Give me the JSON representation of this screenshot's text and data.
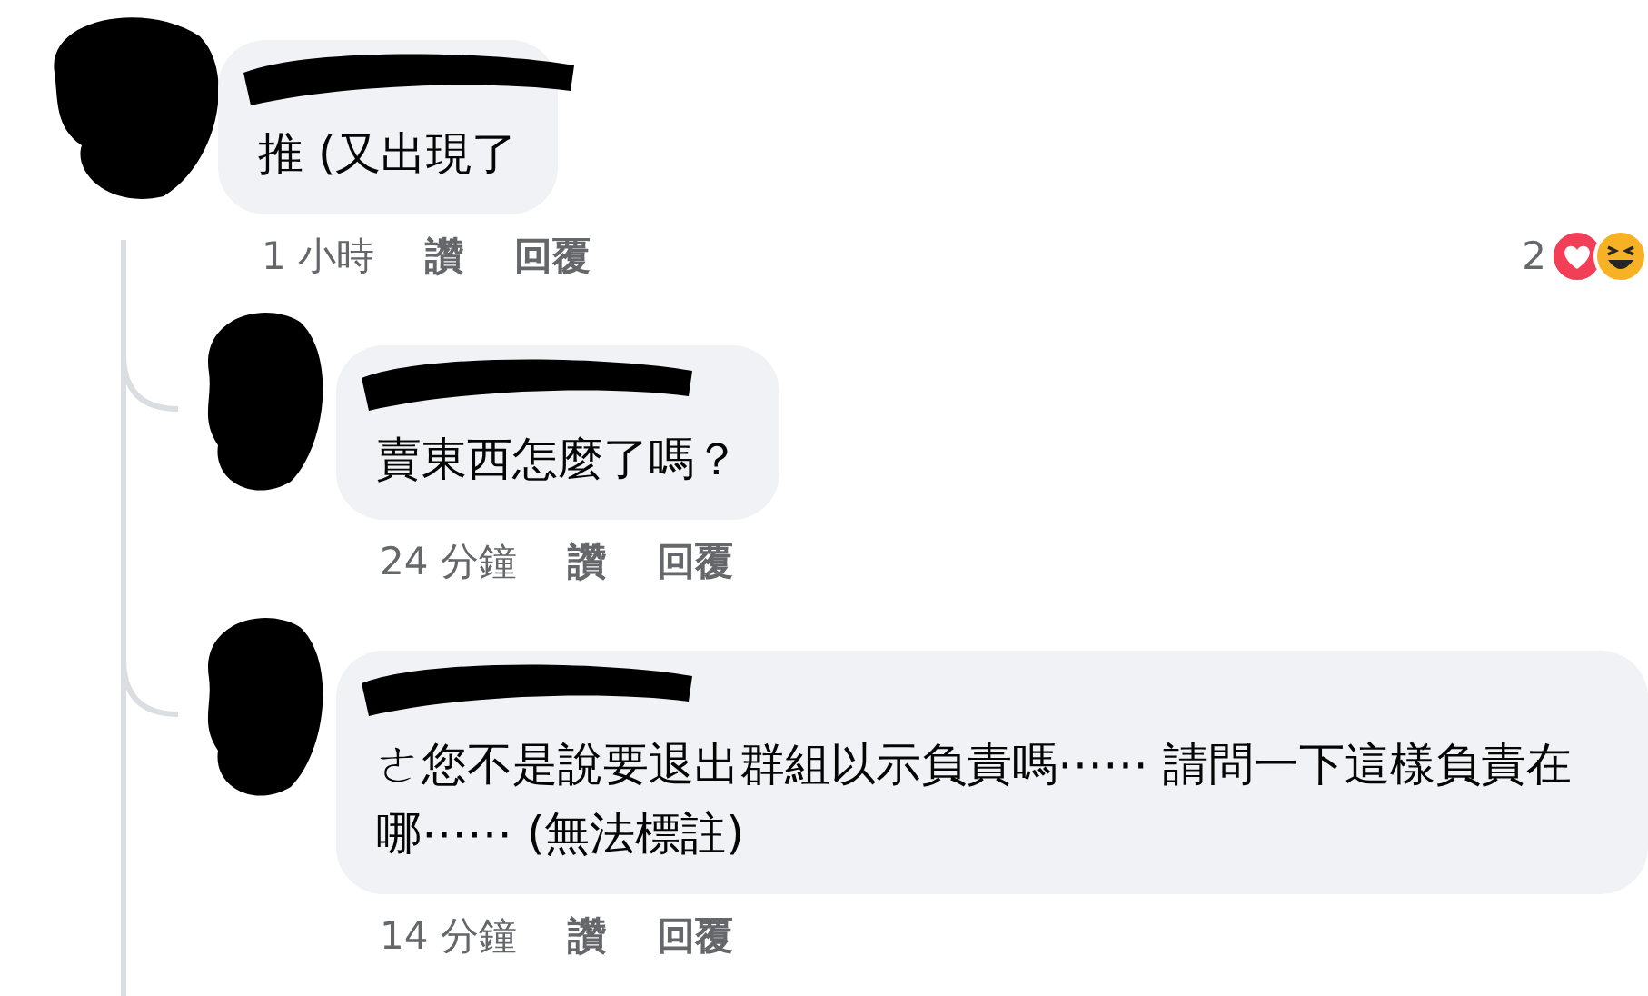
{
  "comments": [
    {
      "text": "推 (又出現了",
      "time": "1 小時",
      "like": "讚",
      "reply": "回覆",
      "reaction_count": "2",
      "replies": [
        {
          "text": "賣東西怎麼了嗎？",
          "time": "24 分鐘",
          "like": "讚",
          "reply": "回覆"
        },
        {
          "text": "ㄜ您不是說要退出群組以示負責嗎⋯⋯ 請問一下這樣負責在哪⋯⋯ (無法標註)",
          "time": "14 分鐘",
          "like": "讚",
          "reply": "回覆"
        }
      ]
    }
  ]
}
